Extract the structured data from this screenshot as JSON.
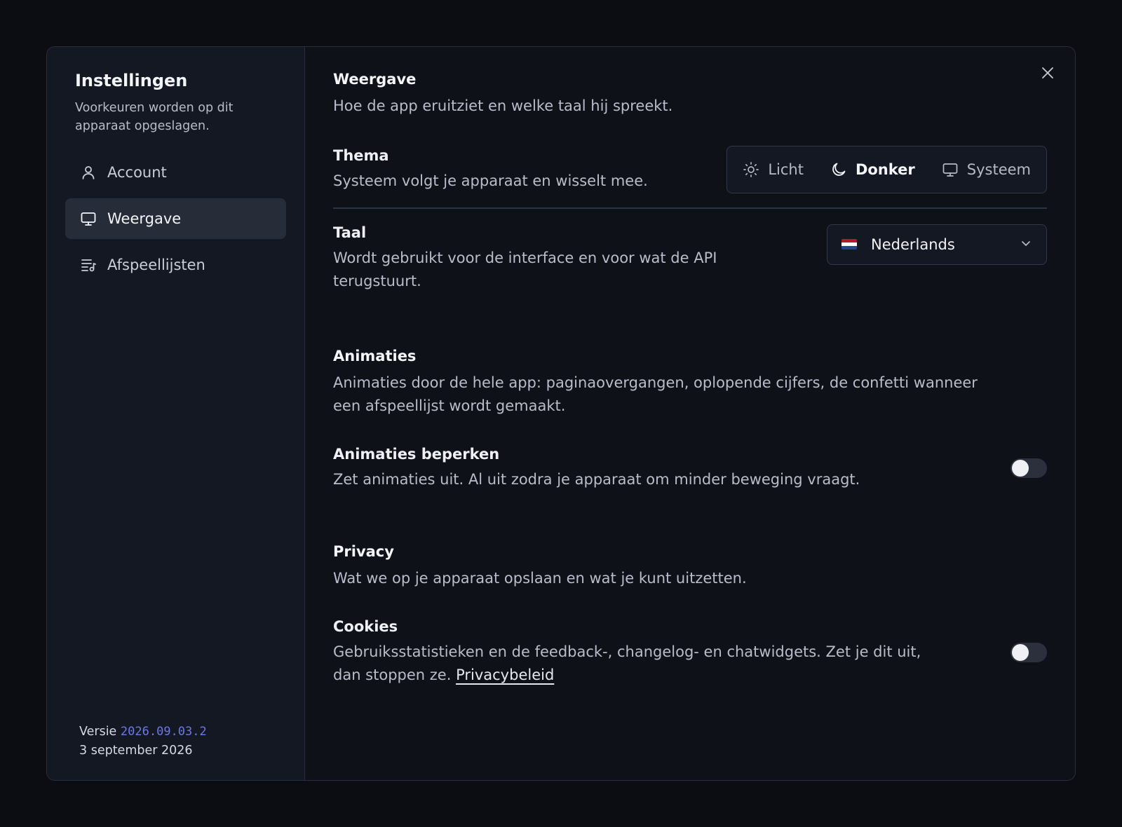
{
  "sidebar": {
    "title": "Instellingen",
    "subtitle": "Voorkeuren worden op dit apparaat opgeslagen.",
    "items": [
      {
        "label": "Account",
        "icon": "user-icon"
      },
      {
        "label": "Weergave",
        "icon": "monitor-icon",
        "active": true
      },
      {
        "label": "Afspeellijsten",
        "icon": "playlist-icon"
      }
    ],
    "version_label": "Versie",
    "version_number": "2026.09.03.2",
    "version_date": "3 september 2026"
  },
  "content": {
    "section_display": {
      "title": "Weergave",
      "description": "Hoe de app eruitziet en welke taal hij spreekt."
    },
    "theme": {
      "title": "Thema",
      "description": "Systeem volgt je apparaat en wisselt mee.",
      "options": [
        {
          "label": "Licht",
          "icon": "sun-icon"
        },
        {
          "label": "Donker",
          "icon": "moon-icon",
          "selected": true
        },
        {
          "label": "Systeem",
          "icon": "monitor-icon"
        }
      ]
    },
    "language": {
      "title": "Taal",
      "description": "Wordt gebruikt voor de interface en voor wat de API terugstuurt.",
      "selected": "Nederlands",
      "flag_colors": [
        "#ae1c28",
        "#ffffff",
        "#21468b"
      ]
    },
    "section_animations": {
      "title": "Animaties",
      "description": "Animaties door de hele app: paginaovergangen, oplopende cijfers, de confetti wanneer een afspeellijst wordt gemaakt."
    },
    "reduce_animations": {
      "title": "Animaties beperken",
      "description": "Zet animaties uit. Al uit zodra je apparaat om minder beweging vraagt.",
      "enabled": false
    },
    "section_privacy": {
      "title": "Privacy",
      "description": "Wat we op je apparaat opslaan en wat je kunt uitzetten."
    },
    "cookies": {
      "title": "Cookies",
      "description": "Gebruiksstatistieken en de feedback-, changelog- en chatwidgets. Zet je dit uit, dan stoppen ze.",
      "link": "Privacybeleid",
      "enabled": false
    }
  },
  "colors": {
    "accent_version": "#6c79e6",
    "background": "#0c0d13"
  }
}
